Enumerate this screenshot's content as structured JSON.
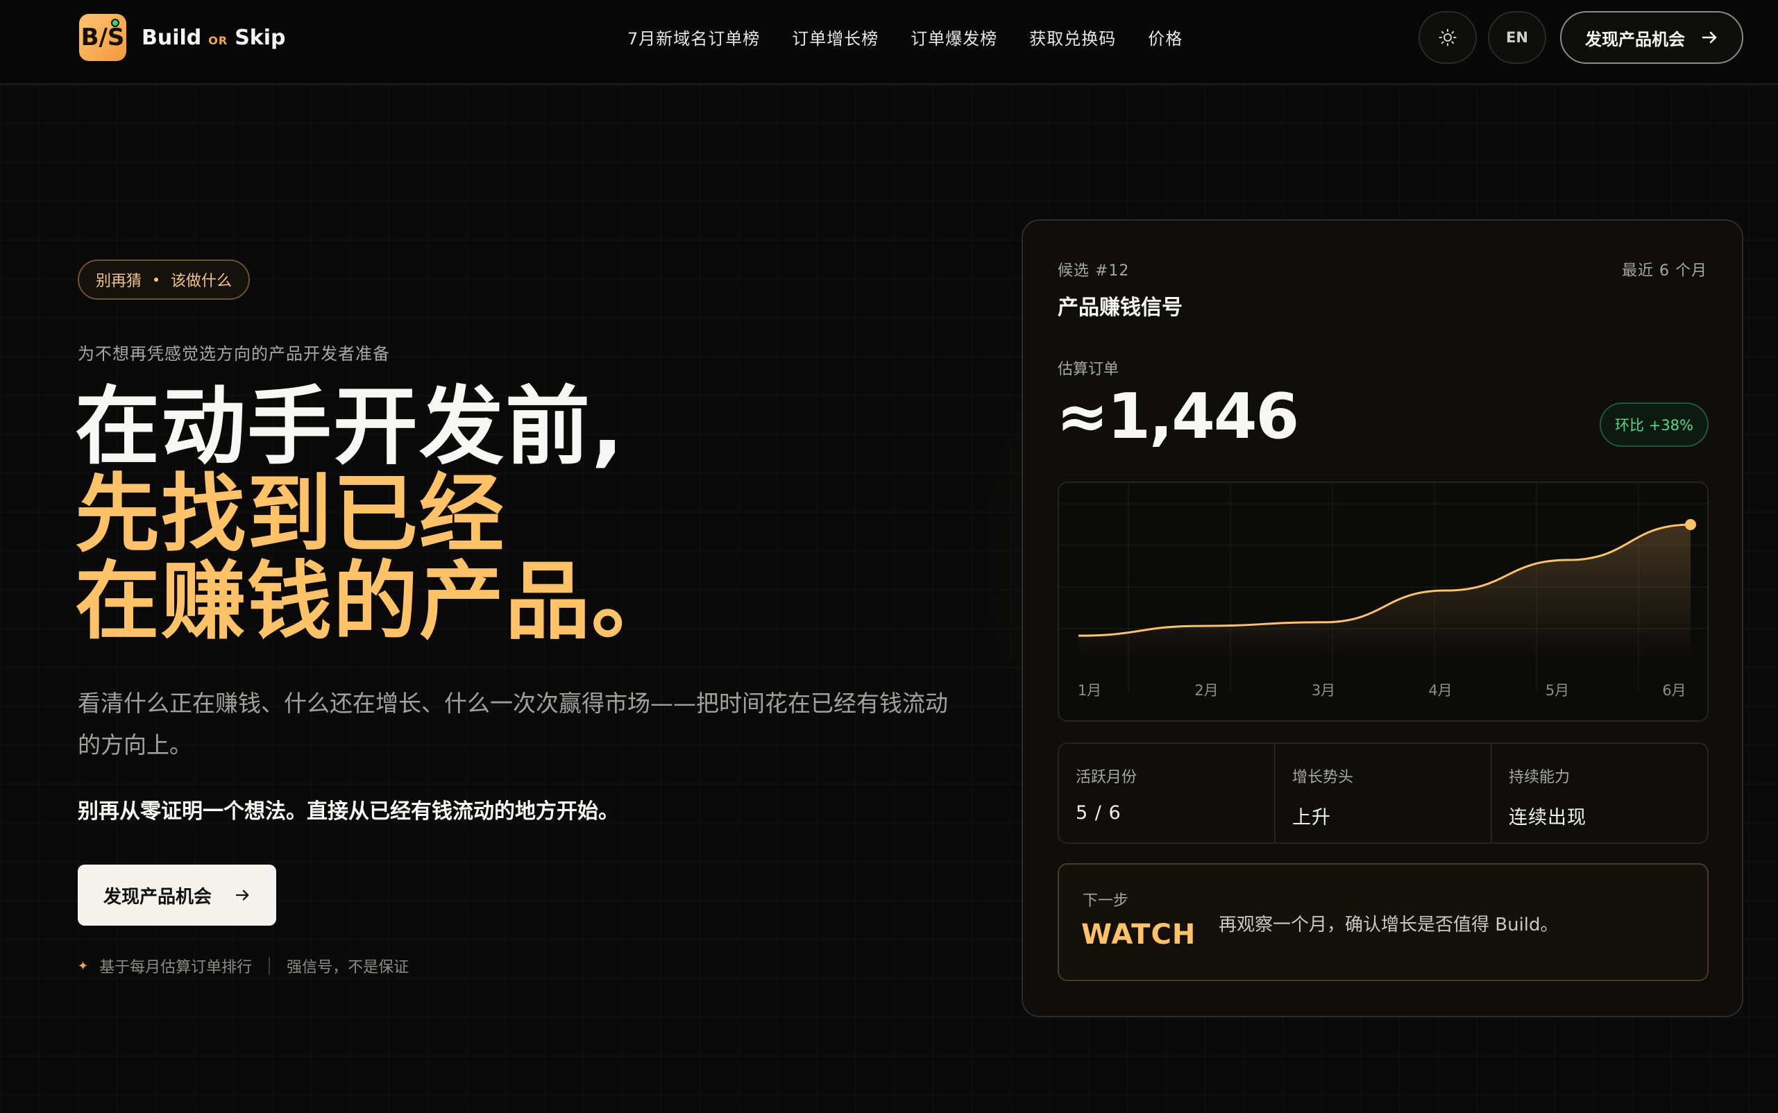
{
  "brand": {
    "logo_letters": "B/S",
    "name_left": "Build",
    "name_or": "OR",
    "name_right": "Skip",
    "accent": "#ffc266",
    "background": "#0a0a0a"
  },
  "nav": {
    "items": [
      "7月新域名订单榜",
      "订单增长榜",
      "订单爆发榜",
      "获取兑换码",
      "价格"
    ]
  },
  "header_actions": {
    "theme_icon": "sun-icon",
    "lang_label": "EN",
    "cta_label": "发现产品机会",
    "cta_icon": "arrow-right-icon"
  },
  "hero": {
    "pill_left": "别再猜",
    "pill_right": "该做什么",
    "subtitle": "为不想再凭感觉选方向的产品开发者准备",
    "headline_line1": "在动手开发前,",
    "headline_line2": "先找到已经",
    "headline_line3": "在赚钱的产品。",
    "description": "看清什么正在赚钱、什么还在增长、什么一次次赢得市场——把时间花在已经有钱流动的方向上。",
    "strong_line": "别再从零证明一个想法。直接从已经有钱流动的地方开始。",
    "cta_label": "发现产品机会",
    "footnote_left": "基于每月估算订单排行",
    "footnote_right": "强信号，不是保证"
  },
  "card": {
    "candidate": "候选 #12",
    "period": "最近 6 个月",
    "title": "产品赚钱信号",
    "est_label": "估算订单",
    "est_value": "≈1,446",
    "badge": "环比 +38%",
    "metrics": [
      {
        "label": "活跃月份",
        "value": "5 / 6"
      },
      {
        "label": "增长势头",
        "value": "上升"
      },
      {
        "label": "持续能力",
        "value": "连续出现"
      }
    ],
    "next_label": "下一步",
    "next_value": "WATCH",
    "next_text": "再观察一个月，确认增长是否值得 Build。"
  },
  "chart_data": {
    "type": "area",
    "categories": [
      "1月",
      "2月",
      "3月",
      "4月",
      "5月",
      "6月"
    ],
    "values": [
      9,
      17,
      20,
      46,
      71,
      100
    ],
    "title": "",
    "xlabel": "",
    "ylabel": "",
    "grid": true,
    "color": "#ffc266"
  }
}
